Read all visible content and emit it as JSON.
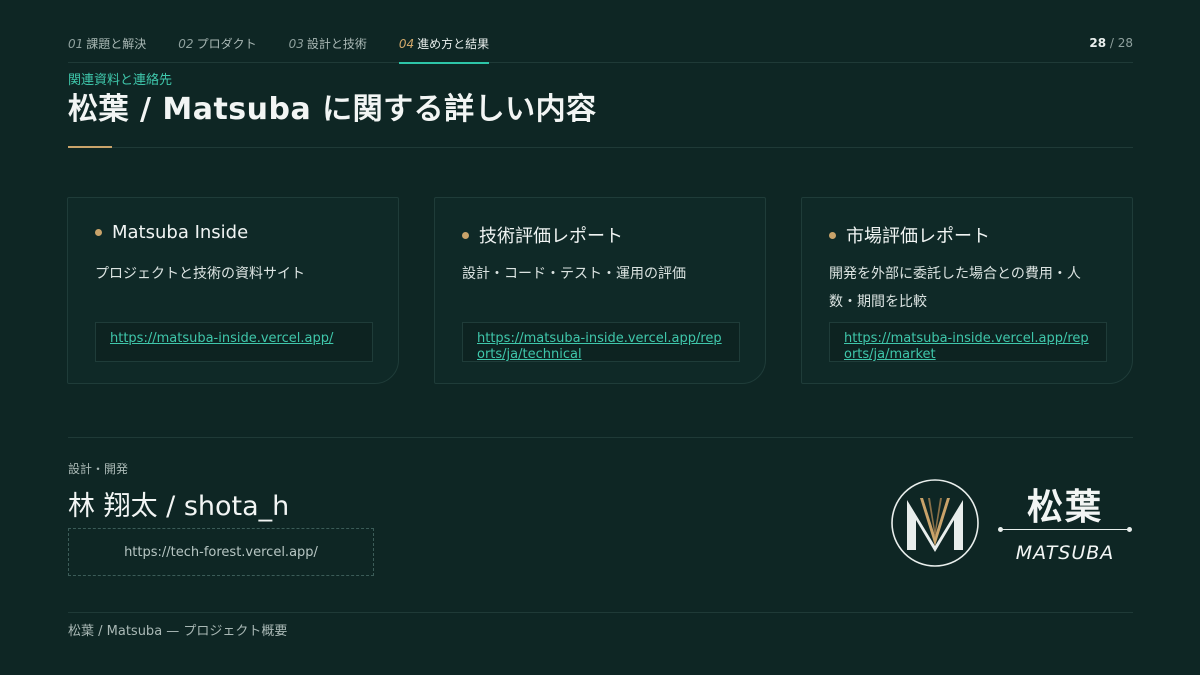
{
  "nav": {
    "tabs": [
      {
        "num": "01",
        "label": "課題と解決"
      },
      {
        "num": "02",
        "label": "プロダクト"
      },
      {
        "num": "03",
        "label": "設計と技術"
      },
      {
        "num": "04",
        "label": "進め方と結果"
      }
    ],
    "active_index": 3,
    "page_current": "28",
    "page_sep": " / ",
    "page_total": "28"
  },
  "header": {
    "eyebrow": "関連資料と連絡先",
    "title": "松葉 / Matsuba に関する詳しい内容"
  },
  "cards": [
    {
      "title": "Matsuba Inside",
      "desc": "プロジェクトと技術の資料サイト",
      "link": "https://matsuba-inside.vercel.app/"
    },
    {
      "title": "技術評価レポート",
      "desc": "設計・コード・テスト・運用の評価",
      "link": "https://matsuba-inside.vercel.app/reports/ja/technical"
    },
    {
      "title": "市場評価レポート",
      "desc": "開発を外部に委託した場合との費用・人数・期間を比較",
      "link": "https://matsuba-inside.vercel.app/reports/ja/market"
    }
  ],
  "developer": {
    "label": "設計・開発",
    "name": "林 翔太 / shota_h",
    "link": "https://tech-forest.vercel.app/"
  },
  "brand": {
    "kanji": "松葉",
    "roman": "MATSUBA"
  },
  "footer": {
    "text": "松葉 / Matsuba — プロジェクト概要"
  },
  "colors": {
    "background": "#0e2624",
    "accent_teal": "#2dc5a8",
    "accent_gold": "#c9a36a"
  }
}
